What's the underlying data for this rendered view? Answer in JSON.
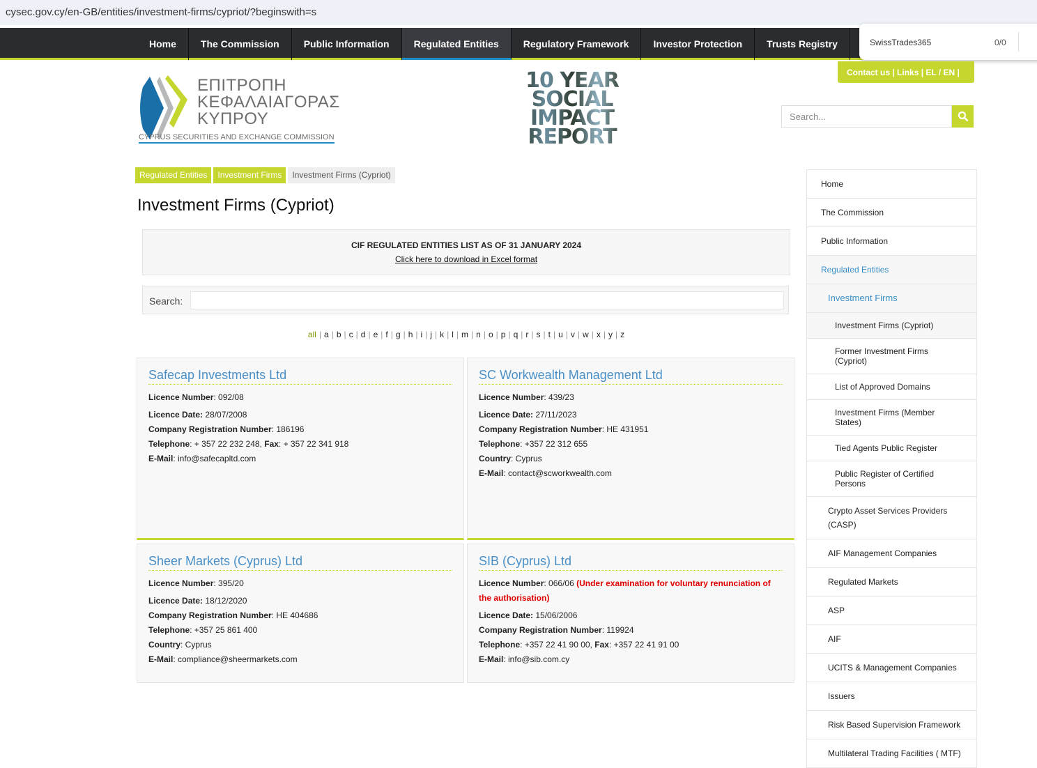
{
  "browser": {
    "url": "cysec.gov.cy/en-GB/entities/investment-firms/cypriot/?beginswith=s",
    "find_query": "SwissTrades365",
    "find_count": "0/0"
  },
  "nav": [
    "Home",
    "The Commission",
    "Public Information",
    "Regulated Entities",
    "Regulatory Framework",
    "Investor Protection",
    "Trusts Registry"
  ],
  "top_links": "Contact us  |  Links  |   EL / EN |",
  "logo": {
    "greek_line1": "ΕΠΙΤΡΟΠΗ",
    "greek_line2": "ΚΕΦΑΛΑΙΑΓΟΡΑΣ",
    "greek_line3": "ΚΥΠΡΟΥ",
    "english": "CYPRUS SECURITIES AND EXCHANGE COMMISSION"
  },
  "banner": [
    "10 YEAR",
    "SOCIAL",
    "IMPACT",
    "REPORT"
  ],
  "search_placeholder": "Search...",
  "breadcrumb": [
    "Regulated Entities",
    "Investment Firms",
    "Investment Firms (Cypriot)"
  ],
  "title": "Investment Firms (Cypriot)",
  "notice": {
    "title": "CIF REGULATED ENTITIES LIST AS OF 31 JANUARY 2024",
    "link": "Click here to download in Excel format"
  },
  "filter": {
    "label": "Search:",
    "value": ""
  },
  "alphabet": [
    "all",
    "a",
    "b",
    "c",
    "d",
    "e",
    "f",
    "g",
    "h",
    "i",
    "j",
    "k",
    "l",
    "m",
    "n",
    "o",
    "p",
    "q",
    "r",
    "s",
    "t",
    "u",
    "v",
    "w",
    "x",
    "y",
    "z"
  ],
  "firms": [
    {
      "name": "Safecap Investments Ltd",
      "fields": [
        {
          "label": "Licence Number",
          "value": "092/08"
        },
        {
          "label": "Licence Date:",
          "value": "28/07/2008"
        },
        {
          "label": "Company Registration Number",
          "value": "186196"
        },
        {
          "label": "Telephone",
          "value": "+ 357 22 232 248, ",
          "label2": "Fax",
          "value2": "+ 357 22 341 918"
        },
        {
          "label": "E-Mail",
          "value": "info@safecapltd.com"
        }
      ]
    },
    {
      "name": "SC Workwealth Management Ltd",
      "fields": [
        {
          "label": "Licence Number",
          "value": "439/23"
        },
        {
          "label": "Licence Date:",
          "value": "27/11/2023"
        },
        {
          "label": "Company Registration Number",
          "value": "HE 431951"
        },
        {
          "label": "Telephone",
          "value": "+357 22 312 655"
        },
        {
          "label": "Country",
          "value": "Cyprus"
        },
        {
          "label": "E-Mail",
          "value": "contact@scworkwealth.com"
        }
      ]
    },
    {
      "name": "Sheer Markets (Cyprus) Ltd",
      "fields": [
        {
          "label": "Licence Number",
          "value": "395/20"
        },
        {
          "label": "Licence Date:",
          "value": "18/12/2020"
        },
        {
          "label": "Company Registration Number",
          "value": "HE 404686"
        },
        {
          "label": "Telephone",
          "value": "+357 25 861 400"
        },
        {
          "label": "Country",
          "value": "Cyprus"
        },
        {
          "label": "E-Mail",
          "value": "compliance@sheermarkets.com"
        }
      ]
    },
    {
      "name": "SIB (Cyprus) Ltd",
      "fields": [
        {
          "label": "Licence Number",
          "value": "066/06",
          "note": "(Under examination for voluntary renunciation of the authorisation)"
        },
        {
          "label": "Licence Date:",
          "value": "15/06/2006"
        },
        {
          "label": "Company Registration Number",
          "value": "119924"
        },
        {
          "label": "Telephone",
          "value": "+357 22 41 90 00, ",
          "label2": "Fax",
          "value2": "+357 22 41 91 00"
        },
        {
          "label": "E-Mail",
          "value": "info@sib.com.cy"
        }
      ]
    }
  ],
  "sidebar": [
    {
      "label": "Home",
      "level": 0
    },
    {
      "label": "The Commission",
      "level": 0
    },
    {
      "label": "Public Information",
      "level": 0
    },
    {
      "label": "Regulated Entities",
      "level": 0,
      "active": true
    },
    {
      "label": "Investment Firms",
      "level": 1,
      "active": true
    },
    {
      "label": "Investment Firms (Cypriot)",
      "level": 2,
      "current": true
    },
    {
      "label": "Former Investment Firms (Cypriot)",
      "level": 2
    },
    {
      "label": "List of Approved Domains",
      "level": 2
    },
    {
      "label": "Investment Firms (Member States)",
      "level": 2
    },
    {
      "label": "Tied Agents Public Register",
      "level": 2
    },
    {
      "label": "Public Register of Certified Persons",
      "level": 2
    },
    {
      "label": "Crypto Asset Services Providers (CASP)",
      "level": 1
    },
    {
      "label": "AIF Management Companies",
      "level": 1
    },
    {
      "label": "Regulated Markets",
      "level": 1
    },
    {
      "label": "ASP",
      "level": 1
    },
    {
      "label": "AIF",
      "level": 1
    },
    {
      "label": "UCITS & Management Companies",
      "level": 1
    },
    {
      "label": "Issuers",
      "level": 1
    },
    {
      "label": "Risk Based Supervision Framework",
      "level": 1
    },
    {
      "label": "Multilateral Trading Facilities ( MTF)",
      "level": 1
    }
  ],
  "colors": {
    "accent": "#c5d62e",
    "link": "#4a90c8",
    "nav": "#2b2c30",
    "warning": "#e00000"
  }
}
